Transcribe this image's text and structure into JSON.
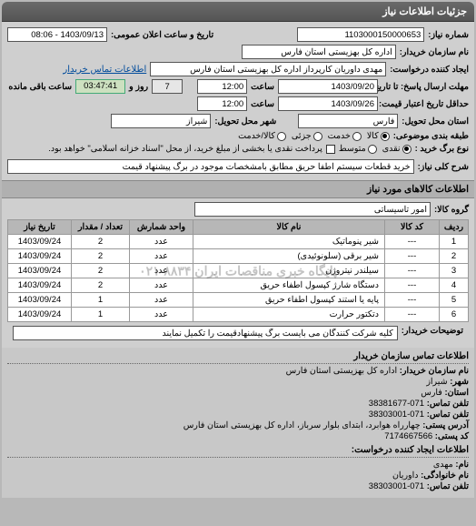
{
  "panel_title": "جزئیات اطلاعات نیاز",
  "accent": "#cde0c0",
  "form": {
    "req_no_label": "شماره نیاز:",
    "req_no": "1103000150000653",
    "announce_label": "تاریخ و ساعت اعلان عمومی:",
    "announce": "1403/09/13 - 08:06",
    "buyer_label": "نام سازمان خریدار:",
    "buyer": "اداره کل بهزیستی استان فارس",
    "requester_label": "ایجاد کننده درخواست:",
    "requester": "مهدی داوریان کارپرداز اداره کل بهزیستی استان فارس",
    "buyer_contact_link_label": "اطلاعات تماس خریدار",
    "deadline_to_label": "مهلت ارسال پاسخ: تا تاریخ:",
    "deadline_to_date": "1403/09/20",
    "time_label": "ساعت",
    "deadline_to_time": "12:00",
    "days_remaining": "7",
    "days_and_label": "روز و",
    "countdown": "03:47:41",
    "remaining_label": "ساعت باقی مانده",
    "validity_label": "حداقل تاریخ اعتبار قیمت: تا تاریخ:",
    "validity_date": "1403/09/26",
    "validity_time": "12:00",
    "province_label": "استان محل تحویل:",
    "province": "فارس",
    "city_label": "شهر محل تحویل:",
    "city": "شیراز",
    "budget_label": "طبقه بندی موضوعی:",
    "budget_options": [
      "کالا",
      "خدمت",
      "جزئی",
      "کالا/خدمت"
    ],
    "budget_selected": 0,
    "payment_label": "نوع برگ خرید :",
    "payment_options": [
      "نقدی",
      "متوسط"
    ],
    "payment_selected": 0,
    "payment_note": "پرداخت نقدی یا بخشی از مبلغ خرید، از محل \"اسناد خزانه اسلامی\" خواهد بود.",
    "payment_note_checked": false
  },
  "desc": {
    "label": "شرح کلی نیاز:",
    "value": "خرید قطعات سیستم اطفا حریق مطابق بامشخصات موجود در برگ پیشنهاد قیمت"
  },
  "goods_header": "اطلاعات کالاهای مورد نیاز",
  "group": {
    "label": "گروه کالا:",
    "value": "امور تاسیساتی"
  },
  "table": {
    "cols": [
      "ردیف",
      "کد کالا",
      "نام کالا",
      "واحد شمارش",
      "تعداد / مقدار",
      "تاریخ نیاز"
    ],
    "rows": [
      {
        "idx": "1",
        "code": "---",
        "name": "شیر پنوماتیک",
        "unit": "عدد",
        "qty": "2",
        "date": "1403/09/24"
      },
      {
        "idx": "2",
        "code": "---",
        "name": "شیر برقی (سلونوئیدی)",
        "unit": "عدد",
        "qty": "2",
        "date": "1403/09/24"
      },
      {
        "idx": "3",
        "code": "---",
        "name": "سیلندر نیتروژن",
        "unit": "عدد",
        "qty": "2",
        "date": "1403/09/24"
      },
      {
        "idx": "4",
        "code": "---",
        "name": "دستگاه شارژ کپسول اطفاء حریق",
        "unit": "عدد",
        "qty": "2",
        "date": "1403/09/24"
      },
      {
        "idx": "5",
        "code": "---",
        "name": "پایه یا استند کپسول اطفاء حریق",
        "unit": "عدد",
        "qty": "1",
        "date": "1403/09/24"
      },
      {
        "idx": "6",
        "code": "---",
        "name": "دتکتور حرارت",
        "unit": "عدد",
        "qty": "1",
        "date": "1403/09/24"
      }
    ]
  },
  "watermark": "پایگاه خبری مناقصات ایران ۸۸۳۴-۰۲۱",
  "buyer_note": {
    "label": "توضیحات خریدار:",
    "value": "کلیه شرکت کنندگان می بایست برگ پیشنهادقیمت را تکمیل نمایند"
  },
  "contacts": {
    "org_header": "اطلاعات تماس سازمان خریدار",
    "org_name_label": "نام سازمان خریدار:",
    "org_name": "اداره کل بهزیستی استان فارس",
    "city_label": "شهر:",
    "city": "شیراز",
    "province_label": "استان:",
    "province": "فارس",
    "phone_label": "تلفن تماس:",
    "phone": "071-38381677",
    "fax_label": "تلفن تماس:",
    "fax": "071-38303001",
    "addr_label": "آدرس پستی:",
    "addr": "چهارراه هوابرد، ابتدای بلوار سرباز، اداره کل بهزیستی استان فارس",
    "zip_label": "کد پستی:",
    "zip": "7174667566",
    "creator_header": "اطلاعات ایجاد کننده درخواست:",
    "name_label": "نام:",
    "name": "مهدی",
    "family_label": "نام خانوادگی:",
    "family": "داوریان",
    "creator_phone_label": "تلفن تماس:",
    "creator_phone": "071-38303001"
  }
}
